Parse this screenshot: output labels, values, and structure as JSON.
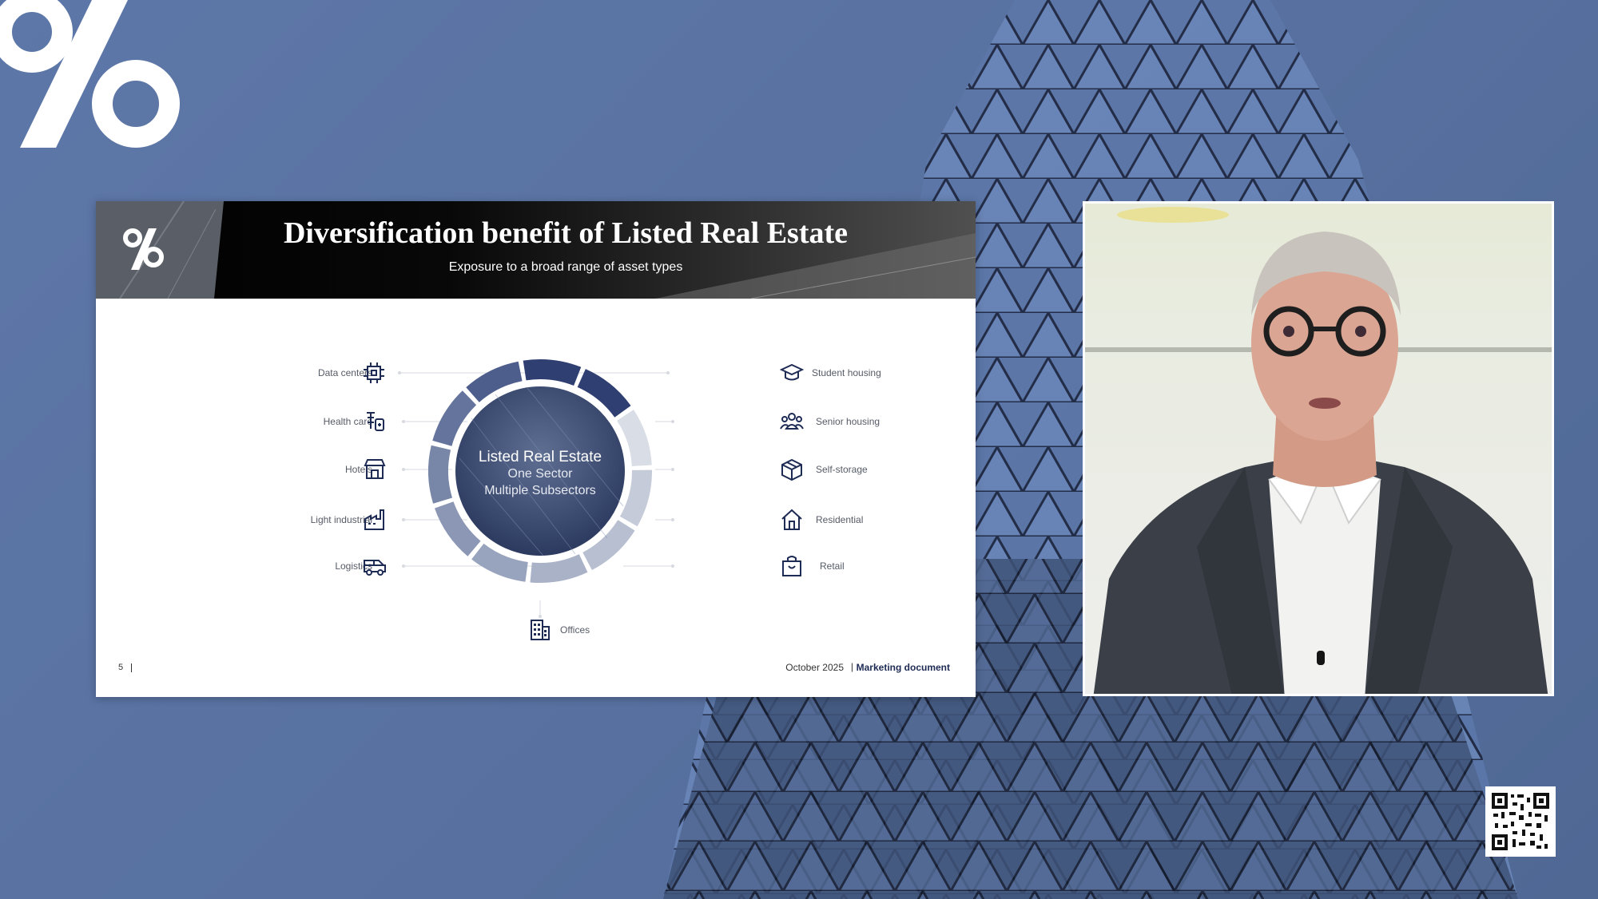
{
  "slide": {
    "title": "Diversification benefit of Listed Real Estate",
    "subtitle": "Exposure to a broad range of asset types",
    "page_number": "5",
    "footer_date": "October 2025",
    "footer_separator": "|",
    "footer_doc": "Marketing document"
  },
  "diagram": {
    "center": {
      "line1": "Listed Real Estate",
      "line2": "One Sector",
      "line3": "Multiple Subsectors"
    },
    "left_items": [
      {
        "label": "Data centers",
        "icon": "chip-icon"
      },
      {
        "label": "Health care",
        "icon": "medical-icon"
      },
      {
        "label": "Hotels",
        "icon": "store-icon"
      },
      {
        "label": "Light industrial",
        "icon": "factory-icon"
      },
      {
        "label": "Logistics",
        "icon": "van-icon"
      }
    ],
    "right_items": [
      {
        "label": "Student housing",
        "icon": "graduation-cap-icon"
      },
      {
        "label": "Senior housing",
        "icon": "people-icon"
      },
      {
        "label": "Self-storage",
        "icon": "box-icon"
      },
      {
        "label": "Residential",
        "icon": "house-icon"
      },
      {
        "label": "Retail",
        "icon": "shopping-bag-icon"
      }
    ],
    "bottom_item": {
      "label": "Offices",
      "icon": "office-building-icon"
    }
  },
  "colors": {
    "background": "#5a74a3",
    "navy": "#1e2b55",
    "ring_dark": "#2f3f72",
    "ring_light": "#d3d8e2"
  }
}
